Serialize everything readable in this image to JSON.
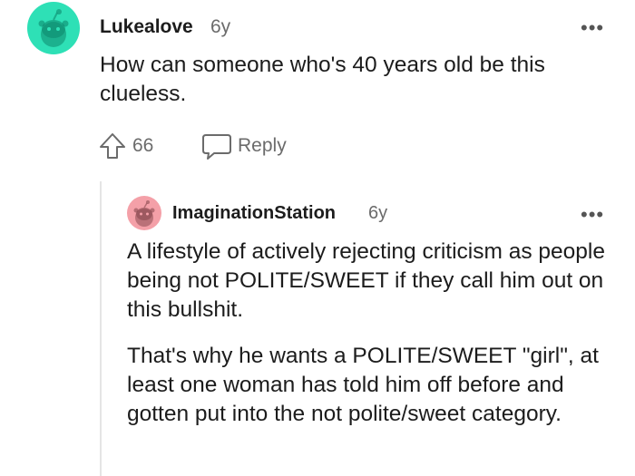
{
  "comments": [
    {
      "username": "Lukealove",
      "age": "6y",
      "body": "How can someone who's 40 years old be this clueless.",
      "votes": "66",
      "reply_label": "Reply",
      "avatar_color": "#2ee0b6"
    },
    {
      "username": "ImaginationStation",
      "age": "6y",
      "paragraphs": [
        "A lifestyle of actively rejecting criticism as people being not POLITE/SWEET if they call him out on this bullshit.",
        "That's why he wants a POLITE/SWEET \"girl\", at least one woman has told him off before and gotten put into the not polite/sweet category."
      ],
      "avatar_color": "#f4a0a8"
    }
  ],
  "icons": {
    "more": "more-options-icon",
    "upvote": "upvote-arrow-icon",
    "reply": "speech-bubble-icon",
    "avatar": "reddit-snoo-icon"
  },
  "more_glyph": "•••"
}
